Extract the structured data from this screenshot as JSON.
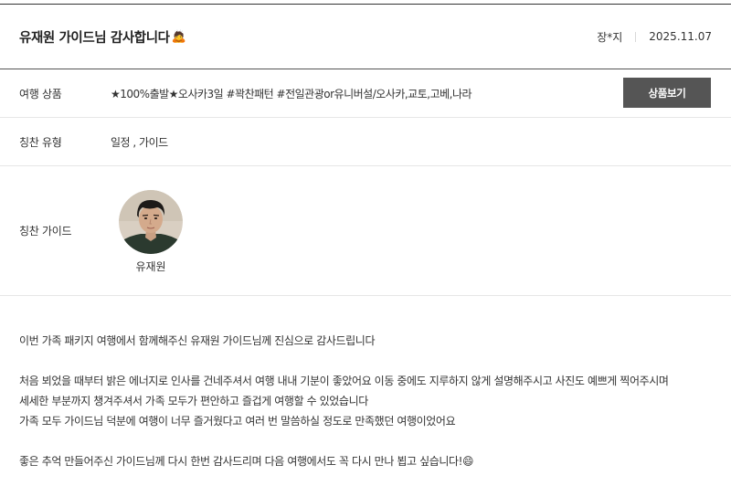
{
  "review": {
    "title": "유재원 가이드님 감사합니다",
    "title_emoji": "🙇",
    "author": "장*지",
    "date": "2025.11.07"
  },
  "product": {
    "label": "여행 상품",
    "value": "★100%출발★오사카3일 #꽉찬패턴 #전일관광or유니버설/오사카,교토,고베,나라",
    "button_label": "상품보기"
  },
  "praise_type": {
    "label": "칭찬 유형",
    "value": "일정 , 가이드"
  },
  "praise_guide": {
    "label": "칭찬 가이드",
    "guide_name": "유재원"
  },
  "content": {
    "para1": "이번 가족 패키지 여행에서 함께해주신 유재원 가이드님께 진심으로 감사드립니다",
    "para2_line1": "처음 뵈었을 때부터 밝은 에너지로 인사를 건네주셔서 여행 내내 기분이 좋았어요 이동 중에도 지루하지 않게 설명해주시고 사진도 예쁘게 찍어주시며",
    "para2_line2": "세세한 부분까지 챙겨주셔서 가족 모두가 편안하고 즐겁게 여행할 수 있었습니다",
    "para2_line3": "가족 모두 가이드님 덕분에 여행이 너무 즐거웠다고 여러 번 말씀하실 정도로 만족했던 여행이었어요",
    "para3": "좋은 추억 만들어주신 가이드님께 다시 한번 감사드리며 다음 여행에서도 꼭 다시 만나 뵙고 싶습니다!",
    "para3_emoji": "😄"
  }
}
